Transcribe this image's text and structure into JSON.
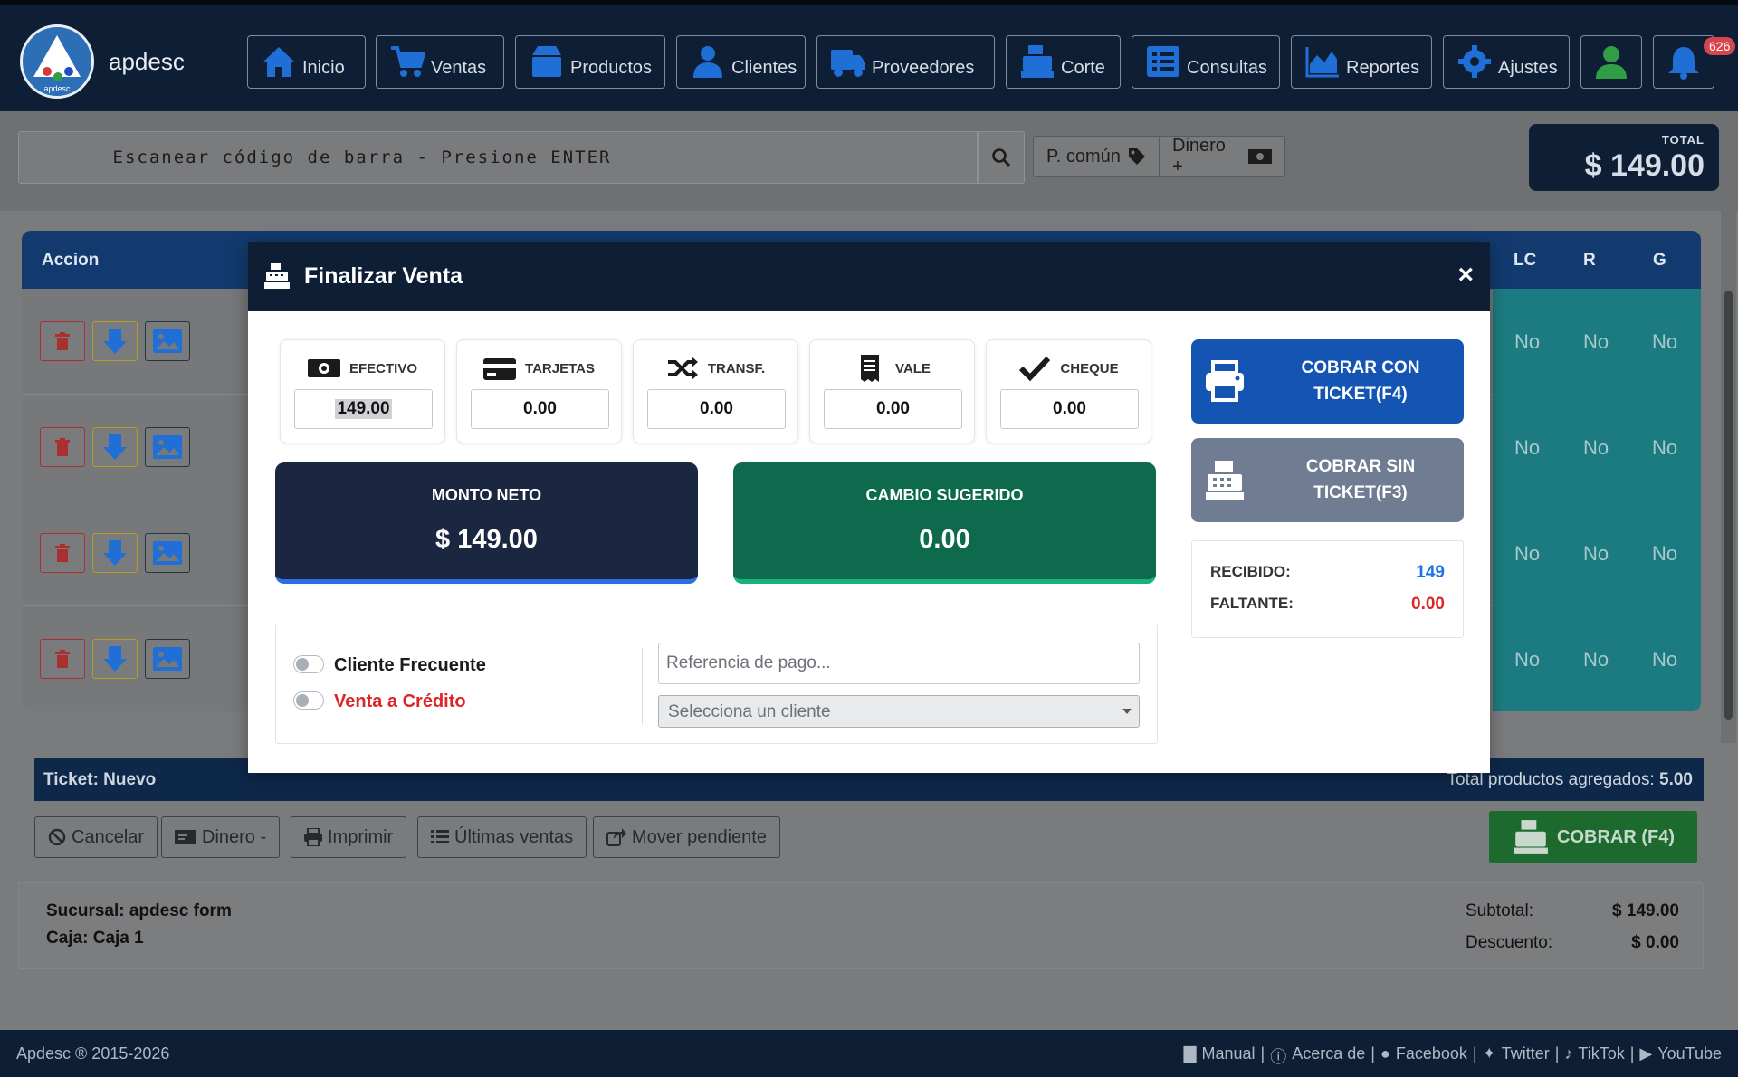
{
  "brand": {
    "name": "apdesc",
    "logo_text": "apdesc"
  },
  "nav": [
    {
      "label": "Inicio",
      "icon": "home-icon"
    },
    {
      "label": "Ventas",
      "icon": "cart-icon"
    },
    {
      "label": "Productos",
      "icon": "box-icon"
    },
    {
      "label": "Clientes",
      "icon": "user-tie-icon"
    },
    {
      "label": "Proveedores",
      "icon": "truck-icon"
    },
    {
      "label": "Corte",
      "icon": "cash-register-icon"
    },
    {
      "label": "Consultas",
      "icon": "list-icon"
    },
    {
      "label": "Reportes",
      "icon": "area-chart-icon"
    },
    {
      "label": "Ajustes",
      "icon": "gear-icon"
    }
  ],
  "notifications": {
    "count": "626"
  },
  "search": {
    "placeholder": "Escanear código de barra - Presione ENTER"
  },
  "price_mode": {
    "label": "P. común"
  },
  "money_in": {
    "label": "Dinero +"
  },
  "total": {
    "label": "TOTAL",
    "value": "$ 149.00"
  },
  "table": {
    "headers": {
      "action": "Accion",
      "lc": "LC",
      "r": "R",
      "g": "G"
    },
    "rows": [
      {
        "lc": "No",
        "r": "No",
        "g": "No"
      },
      {
        "lc": "No",
        "r": "No",
        "g": "No"
      },
      {
        "lc": "No",
        "r": "No",
        "g": "No"
      },
      {
        "lc": "No",
        "r": "No",
        "g": "No"
      }
    ]
  },
  "ticket": {
    "label": "Ticket: Nuevo",
    "products_label": "Total productos agregados:",
    "products_value": "5.00"
  },
  "actions": {
    "cancel": "Cancelar",
    "money_out": "Dinero -",
    "print": "Imprimir",
    "last_sales": "Últimas ventas",
    "move_pending": "Mover pendiente",
    "charge": "COBRAR (F4)"
  },
  "info": {
    "branch": "Sucursal: apdesc form",
    "register": "Caja: Caja 1",
    "subtotal_label": "Subtotal:",
    "subtotal_value": "$ 149.00",
    "discount_label": "Descuento:",
    "discount_value": "$ 0.00"
  },
  "footer": {
    "copyright": "Apdesc ® 2015-2026",
    "links": [
      "Manual",
      "Acerca de",
      "Facebook",
      "Twitter",
      "TikTok",
      "YouTube"
    ]
  },
  "modal": {
    "title": "Finalizar Venta",
    "close": "×",
    "methods": [
      {
        "label": "EFECTIVO",
        "value": "149.00",
        "icon": "money-bill-icon"
      },
      {
        "label": "TARJETAS",
        "value": "0.00",
        "icon": "credit-card-icon"
      },
      {
        "label": "TRANSF.",
        "value": "0.00",
        "icon": "shuffle-icon"
      },
      {
        "label": "VALE",
        "value": "0.00",
        "icon": "receipt-icon"
      },
      {
        "label": "CHEQUE",
        "value": "0.00",
        "icon": "check-icon"
      }
    ],
    "net": {
      "label": "MONTO NETO",
      "value": "$ 149.00"
    },
    "change": {
      "label": "CAMBIO SUGERIDO",
      "value": "0.00"
    },
    "frequent_client": "Cliente Frecuente",
    "credit_sale": "Venta a Crédito",
    "reference_placeholder": "Referencia de pago...",
    "client_select": "Selecciona un cliente",
    "charge_with_ticket": "COBRAR CON TICKET(F4)",
    "charge_without_ticket": "COBRAR SIN TICKET(F3)",
    "received_label": "RECIBIDO:",
    "received_value": "149",
    "missing_label": "FALTANTE:",
    "missing_value": "0.00",
    "colors": {
      "received": "#1a73e8",
      "missing": "#dc2626",
      "primary": "#1455b4",
      "success": "#0d6a4c"
    }
  }
}
